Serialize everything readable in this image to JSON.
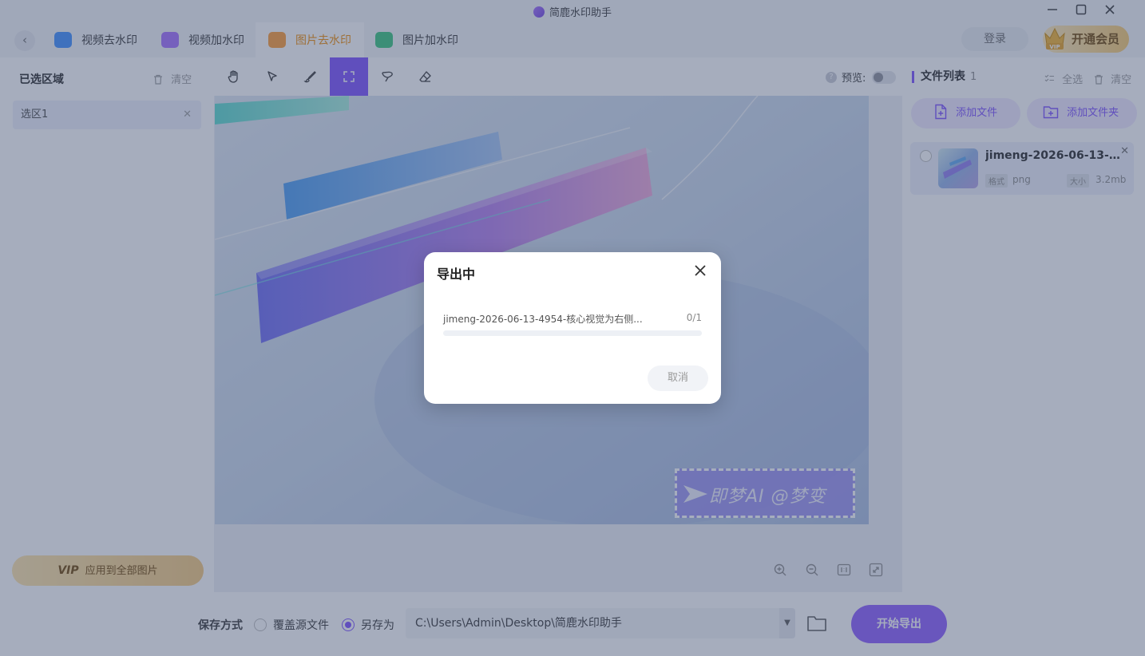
{
  "window": {
    "title": "简鹿水印助手",
    "min_icon": "minimize-icon",
    "max_icon": "maximize-icon",
    "close_icon": "close-icon"
  },
  "tabs": [
    {
      "label": "视频去水印",
      "icon": "video-remove-icon",
      "color": "#3b8cff"
    },
    {
      "label": "视频加水印",
      "icon": "video-add-icon",
      "color": "#a36bff"
    },
    {
      "label": "图片去水印",
      "icon": "image-remove-icon",
      "color": "#ff9a2e",
      "active": true
    },
    {
      "label": "图片加水印",
      "icon": "image-add-icon",
      "color": "#35c47a"
    }
  ],
  "header": {
    "login": "登录",
    "vip": "开通会员",
    "vip_badge": "VIP"
  },
  "left_panel": {
    "title": "已选区域",
    "clear": "清空",
    "selections": [
      {
        "label": "选区1"
      }
    ],
    "apply_vip": "VIP",
    "apply_label": "应用到全部图片"
  },
  "toolbar": {
    "tools": [
      "hand-tool-icon",
      "pointer-tool-icon",
      "brush-tool-icon",
      "rect-select-tool-icon",
      "lasso-tool-icon",
      "eraser-tool-icon"
    ],
    "active_tool": "rect-select-tool-icon",
    "preview_label": "预览:",
    "preview_on": false
  },
  "canvas": {
    "watermark_text": "即梦AI @梦变",
    "zoom_icons": [
      "zoom-in-icon",
      "zoom-out-icon",
      "actual-size-icon",
      "fit-screen-icon"
    ]
  },
  "right_panel": {
    "title": "文件列表",
    "count": "1",
    "select_all": "全选",
    "clear": "清空",
    "add_file": "添加文件",
    "add_folder": "添加文件夹",
    "files": [
      {
        "name": "jimeng-2026-06-13-495...",
        "format_label": "格式",
        "format": "png",
        "size_label": "大小",
        "size": "3.2mb"
      }
    ]
  },
  "bottom": {
    "save_mode_label": "保存方式",
    "option_overwrite": "覆盖源文件",
    "option_save_as": "另存为",
    "selected_option": "save_as",
    "path": "C:\\Users\\Admin\\Desktop\\简鹿水印助手",
    "export": "开始导出"
  },
  "dialog": {
    "title": "导出中",
    "file": "jimeng-2026-06-13-4954-核心视觉为右侧...",
    "count": "0/1",
    "progress": 0,
    "cancel": "取消"
  },
  "colors": {
    "accent": "#7a4bff",
    "overlay": "rgba(70,84,118,0.48)",
    "vip_gold": "#f5c879"
  }
}
